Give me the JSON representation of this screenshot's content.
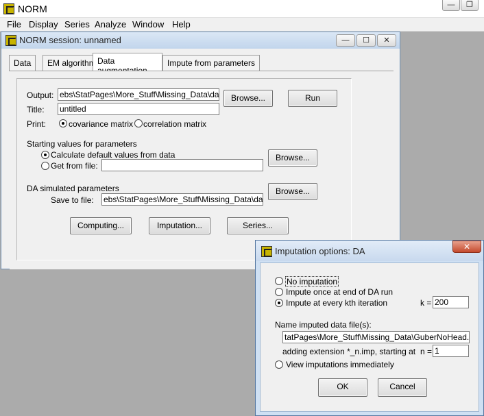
{
  "app": {
    "title": "NORM",
    "menu": [
      "File",
      "Display",
      "Series",
      "Analyze",
      "Window",
      "Help"
    ]
  },
  "session": {
    "title": "NORM session: unnamed",
    "tabs": [
      "Data",
      "EM algorithm",
      "Data augmentation",
      "Impute from parameters"
    ],
    "output_label": "Output:",
    "output_value": "ebs\\StatPages\\More_Stuff\\Missing_Data\\da.out",
    "browse_label": "Browse...",
    "run_label": "Run",
    "title_label": "Title:",
    "title_value": "untitled",
    "print_label": "Print:",
    "print_options": [
      "covariance matrix",
      "correlation matrix"
    ],
    "starting_values_heading": "Starting values for parameters",
    "start_options": [
      "Calculate default values from data",
      "Get from file:"
    ],
    "get_from_file_value": "",
    "da_params_heading": "DA simulated parameters",
    "save_to_file_label": "Save to file:",
    "save_to_file_value": "ebs\\StatPages\\More_Stuff\\Missing_Data\\da.prm",
    "computing_label": "Computing...",
    "imputation_label": "Imputation...",
    "series_label": "Series..."
  },
  "dialog": {
    "title": "Imputation options: DA",
    "close_symbol": "✕",
    "options": [
      "No imputation",
      "Impute once at end of DA run",
      "Impute at every kth iteration"
    ],
    "k_label": "k =",
    "k_value": "200",
    "name_files_label": "Name imputed data file(s):",
    "file_value": "tatPages\\More_Stuff\\Missing_Data\\GuberNoHead.XXX",
    "adding_ext_label": "adding extension *_n.imp, starting at",
    "n_label": "n =",
    "n_value": "1",
    "view_label": "View imputations immediately",
    "ok_label": "OK",
    "cancel_label": "Cancel"
  }
}
